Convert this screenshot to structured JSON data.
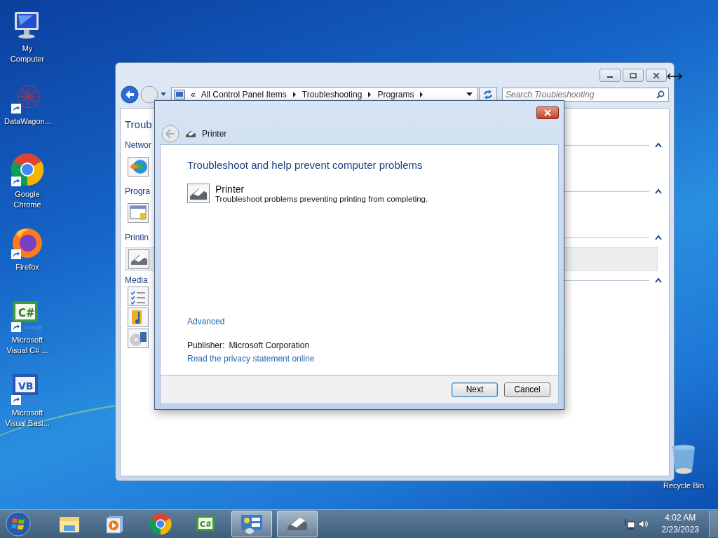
{
  "desktop_icons": [
    {
      "kind": "computer",
      "label": "My Computer",
      "shortcut": false
    },
    {
      "kind": "network-graph",
      "label": "DataWagon...",
      "shortcut": true
    },
    {
      "kind": "chrome",
      "label": "Google Chrome",
      "shortcut": true
    },
    {
      "kind": "firefox",
      "label": "Firefox",
      "shortcut": true
    },
    {
      "kind": "csharp",
      "glyph": "C#",
      "label": "Microsoft Visual C# ...",
      "shortcut": true
    },
    {
      "kind": "vb",
      "glyph": "VB",
      "label": "Microsoft Visual Basi...",
      "shortcut": true
    }
  ],
  "recycle_bin": {
    "label": "Recycle Bin"
  },
  "explorer": {
    "address_prefix": "«",
    "breadcrumb": [
      "All Control Panel Items",
      "Troubleshooting",
      "Programs"
    ],
    "search": {
      "placeholder": "Search Troubleshooting"
    },
    "title": "Troub",
    "sections": [
      {
        "label": "Networ",
        "expanded": true,
        "items": [
          {
            "kind": "network",
            "selected": false
          }
        ]
      },
      {
        "label": "Progra",
        "expanded": true,
        "items": [
          {
            "kind": "programs",
            "selected": false
          }
        ]
      },
      {
        "label": "Printin",
        "expanded": true,
        "items": [
          {
            "kind": "printer",
            "selected": true
          }
        ]
      },
      {
        "label": "Media",
        "expanded": true,
        "items": [
          {
            "kind": "checklist",
            "selected": false
          },
          {
            "kind": "music",
            "selected": false
          },
          {
            "kind": "disc",
            "selected": false
          }
        ]
      }
    ]
  },
  "dialog": {
    "title": "Printer",
    "heading": "Troubleshoot and help prevent computer problems",
    "item": {
      "title": "Printer",
      "description": "Troubleshoot problems preventing printing from completing."
    },
    "advanced_link": "Advanced",
    "publisher_label": "Publisher:",
    "publisher": "Microsoft Corporation",
    "privacy_link": "Read the privacy statement online",
    "buttons": [
      {
        "label": "Next",
        "default": true
      },
      {
        "label": "Cancel",
        "default": false
      }
    ]
  },
  "taskbar": {
    "items": [
      {
        "kind": "folder",
        "open": false
      },
      {
        "kind": "media",
        "open": false
      },
      {
        "kind": "chrome",
        "open": false
      },
      {
        "kind": "csharp",
        "glyph": "C#",
        "open": false
      },
      {
        "kind": "control-panel",
        "open": true
      },
      {
        "kind": "printer",
        "open": true
      }
    ],
    "time": "4:02 AM",
    "date": "2/23/2023"
  }
}
